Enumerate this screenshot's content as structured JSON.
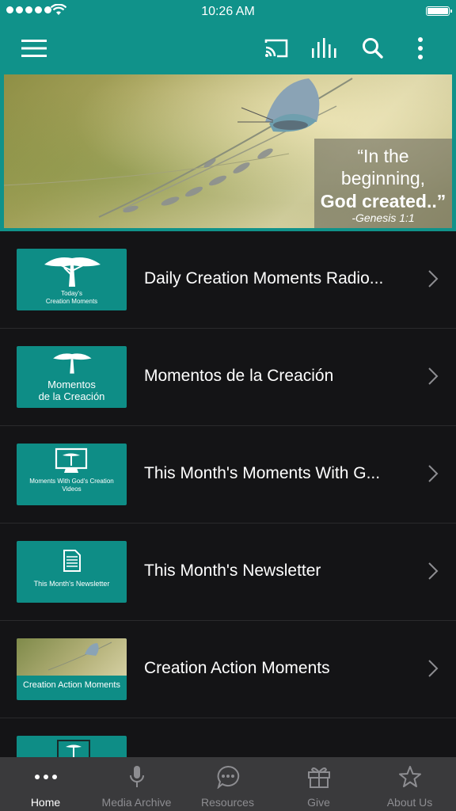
{
  "status_bar": {
    "time": "10:26 AM"
  },
  "toolbar": {
    "icons": [
      "menu-icon",
      "cast-icon",
      "equalizer-icon",
      "search-icon",
      "more-vertical-icon"
    ]
  },
  "banner": {
    "quote_line1": "“In the",
    "quote_line2": "beginning,",
    "quote_line3": "God created..”",
    "quote_ref": "-Genesis 1:1"
  },
  "items": [
    {
      "title": "Daily Creation Moments Radio...",
      "thumb_text": "Today's\nCreation Moments",
      "thumb_icon": "tree-icon"
    },
    {
      "title": "Momentos de la Creación",
      "thumb_text": "Momentos\nde la Creación",
      "thumb_icon": "tree-icon"
    },
    {
      "title": "This Month's Moments With G...",
      "thumb_text": "Moments With God's Creation\nVideos",
      "thumb_icon": "monitor-icon"
    },
    {
      "title": "This Month's Newsletter",
      "thumb_text": "This Month's Newsletter",
      "thumb_icon": "document-icon"
    },
    {
      "title": "Creation Action Moments",
      "thumb_text": "Creation Action Moments",
      "thumb_icon": "butterfly-photo"
    }
  ],
  "tabs": [
    {
      "label": "Home",
      "icon": "more-horizontal-icon",
      "active": true
    },
    {
      "label": "Media Archive",
      "icon": "microphone-icon",
      "active": false
    },
    {
      "label": "Resources",
      "icon": "chat-bubble-icon",
      "active": false
    },
    {
      "label": "Give",
      "icon": "gift-icon",
      "active": false
    },
    {
      "label": "About Us",
      "icon": "star-icon",
      "active": false
    }
  ],
  "colors": {
    "accent": "#10928a",
    "background": "#141416",
    "tabbar": "#3a3a3c"
  }
}
